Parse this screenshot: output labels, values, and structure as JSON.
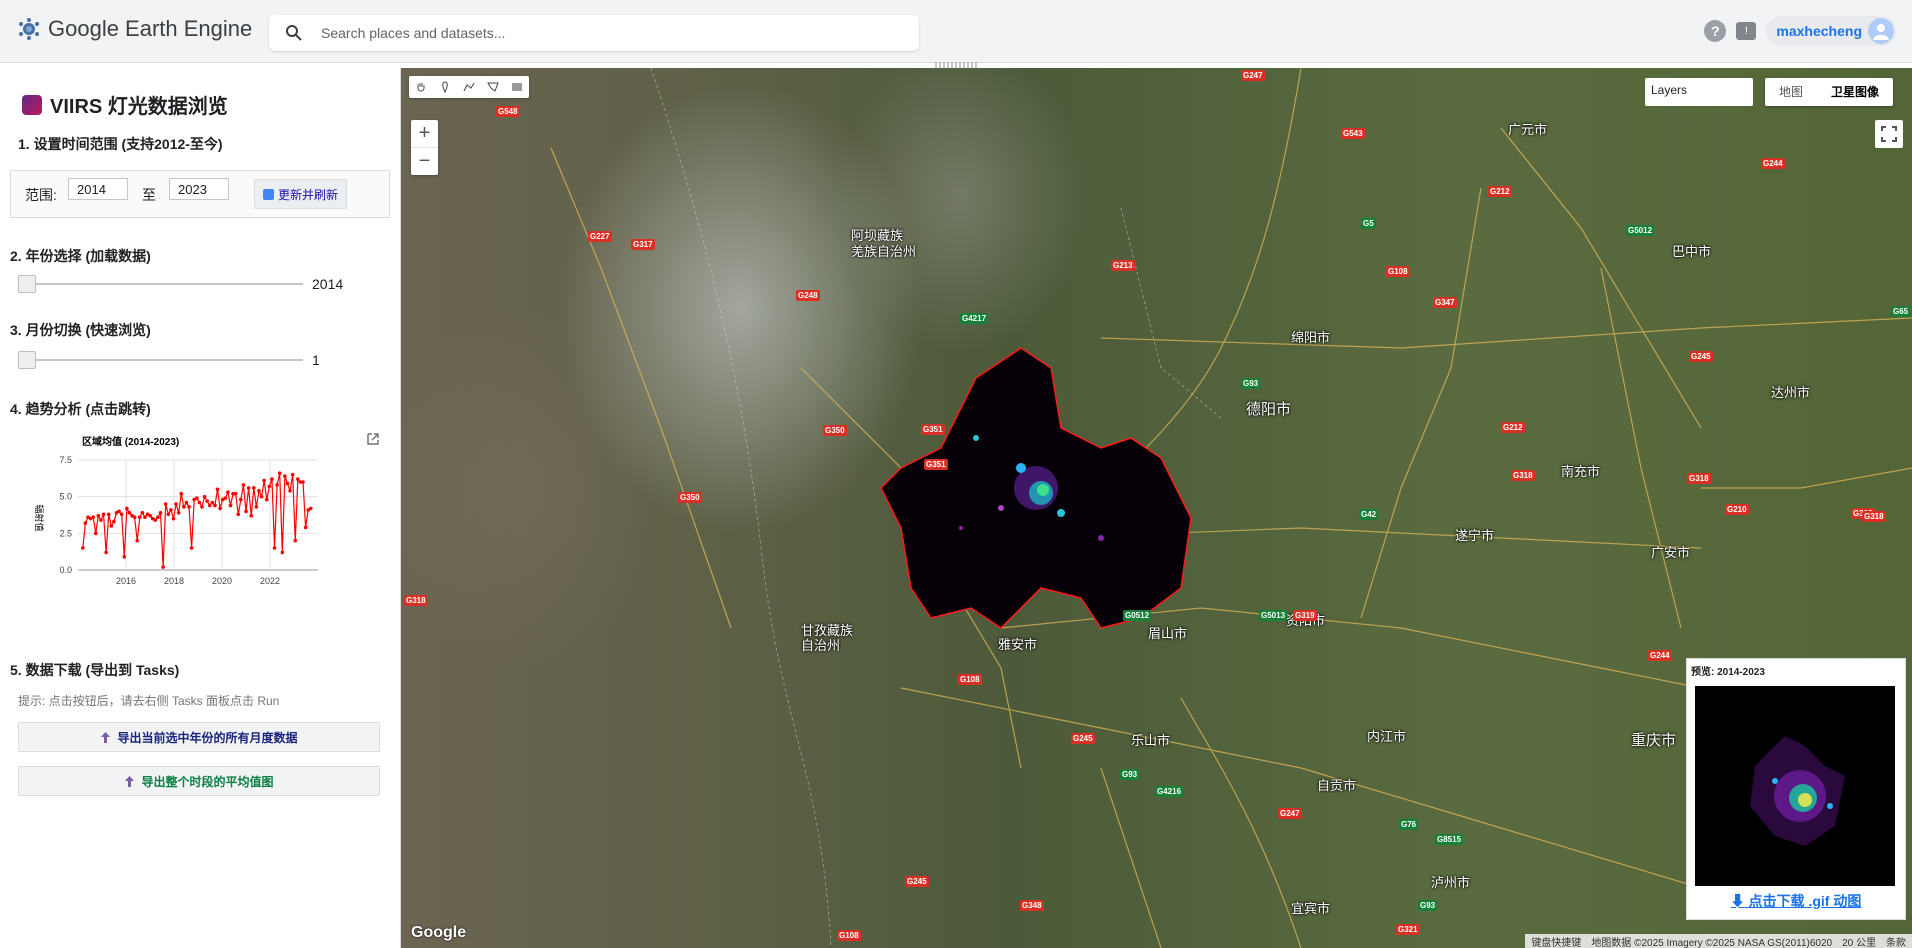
{
  "app": {
    "title": "Google Earth Engine",
    "user": "maxhecheng"
  },
  "search": {
    "placeholder": "Search places and datasets..."
  },
  "icons": {
    "help": "help-icon",
    "feedback": "feedback-icon",
    "avatar": "avatar-icon",
    "search": "search-icon"
  },
  "panel": {
    "title": "VIIRS 灯光数据浏览",
    "sec1": "1. 设置时间范围 (支持2012-至今)",
    "range_label": "范围:",
    "start_year": "2014",
    "to_label": "至",
    "end_year": "2023",
    "refresh_button": "更新并刷新",
    "sec2": "2. 年份选择 (加载数据)",
    "year_value": "2014",
    "sec3": "3. 月份切换 (快速浏览)",
    "month_value": "1",
    "sec4": "4. 趋势分析 (点击跳转)",
    "sec5": "5. 数据下载 (导出到 Tasks)",
    "hint": "提示: 点击按钮后，请去右侧 Tasks 面板点击 Run",
    "export_monthly": "导出当前选中年份的所有月度数据",
    "export_mean": "导出整个时段的平均值图"
  },
  "chart_data": {
    "type": "line",
    "title": "区域均值 (2014-2023)",
    "ylabel": "辐射值",
    "xlabel": "",
    "ylim": [
      0,
      7.5
    ],
    "yticks": [
      "0.0",
      "2.5",
      "5.0",
      "7.5"
    ],
    "xticks": [
      "2016",
      "2018",
      "2020",
      "2022"
    ],
    "x_start": 2014.0,
    "x_end": 2024.0,
    "color": "#ff0000",
    "values": [
      1.5,
      3.2,
      3.6,
      3.5,
      3.6,
      2.5,
      3.7,
      3.4,
      3.8,
      1.2,
      3.8,
      3.0,
      3.3,
      3.9,
      4.0,
      3.8,
      0.9,
      4.2,
      3.9,
      3.7,
      3.6,
      2.0,
      3.6,
      3.9,
      3.6,
      3.8,
      3.7,
      3.5,
      3.4,
      3.6,
      3.9,
      0.2,
      4.5,
      3.8,
      4.1,
      3.5,
      4.5,
      3.9,
      5.2,
      4.3,
      4.6,
      4.3,
      1.5,
      4.8,
      4.9,
      4.6,
      4.3,
      5.0,
      4.7,
      4.4,
      4.6,
      4.4,
      5.5,
      4.2,
      4.8,
      4.9,
      5.3,
      4.4,
      5.2,
      5.2,
      3.8,
      4.8,
      5.8,
      4.0,
      5.6,
      3.7,
      5.6,
      4.3,
      5.4,
      5.0,
      6.1,
      4.8,
      5.7,
      6.2,
      1.5,
      5.8,
      6.6,
      1.2,
      6.4,
      5.9,
      5.4,
      6.5,
      2.0,
      6.2,
      6.0,
      6.0,
      2.9,
      4.1,
      4.2
    ]
  },
  "map": {
    "layers_label": "Layers",
    "maptype_map": "地图",
    "maptype_satellite": "卫星图像",
    "places": [
      "广元市",
      "阿坝藏族",
      "羌族自治州",
      "绵阳市",
      "德阳市",
      "巴中市",
      "达州市",
      "南充市",
      "遂宁市",
      "广安市",
      "雅安市",
      "眉山市",
      "资阳市",
      "乐山市",
      "内江市",
      "自贡市",
      "重庆市",
      "甘孜藏族",
      "自治州",
      "泸州市",
      "宜宾市"
    ],
    "routes": [
      "G247",
      "G548",
      "G543",
      "G244",
      "G227",
      "G317",
      "G213",
      "G5",
      "G212",
      "G5012",
      "G108",
      "G347",
      "G248",
      "G4217",
      "G93",
      "G245",
      "G65",
      "G350",
      "G212",
      "G318",
      "G351",
      "G42",
      "G350",
      "G351",
      "G318",
      "G318",
      "G0512",
      "G5013",
      "G319",
      "G244",
      "G108",
      "G245",
      "G4216",
      "G93",
      "G247",
      "G76",
      "G8515",
      "G245",
      "G348",
      "G93",
      "G321",
      "G108",
      "G318",
      "G210",
      "G318"
    ],
    "preview_title": "预览: 2014-2023",
    "preview_link": "点击下载 .gif 动图",
    "google": "Google",
    "attrib_keys": "键盘快捷键",
    "attrib_data": "地图数据 ©2025 Imagery ©2025 NASA GS(2011)6020",
    "attrib_scale": "20 公里",
    "attrib_terms": "条款"
  }
}
